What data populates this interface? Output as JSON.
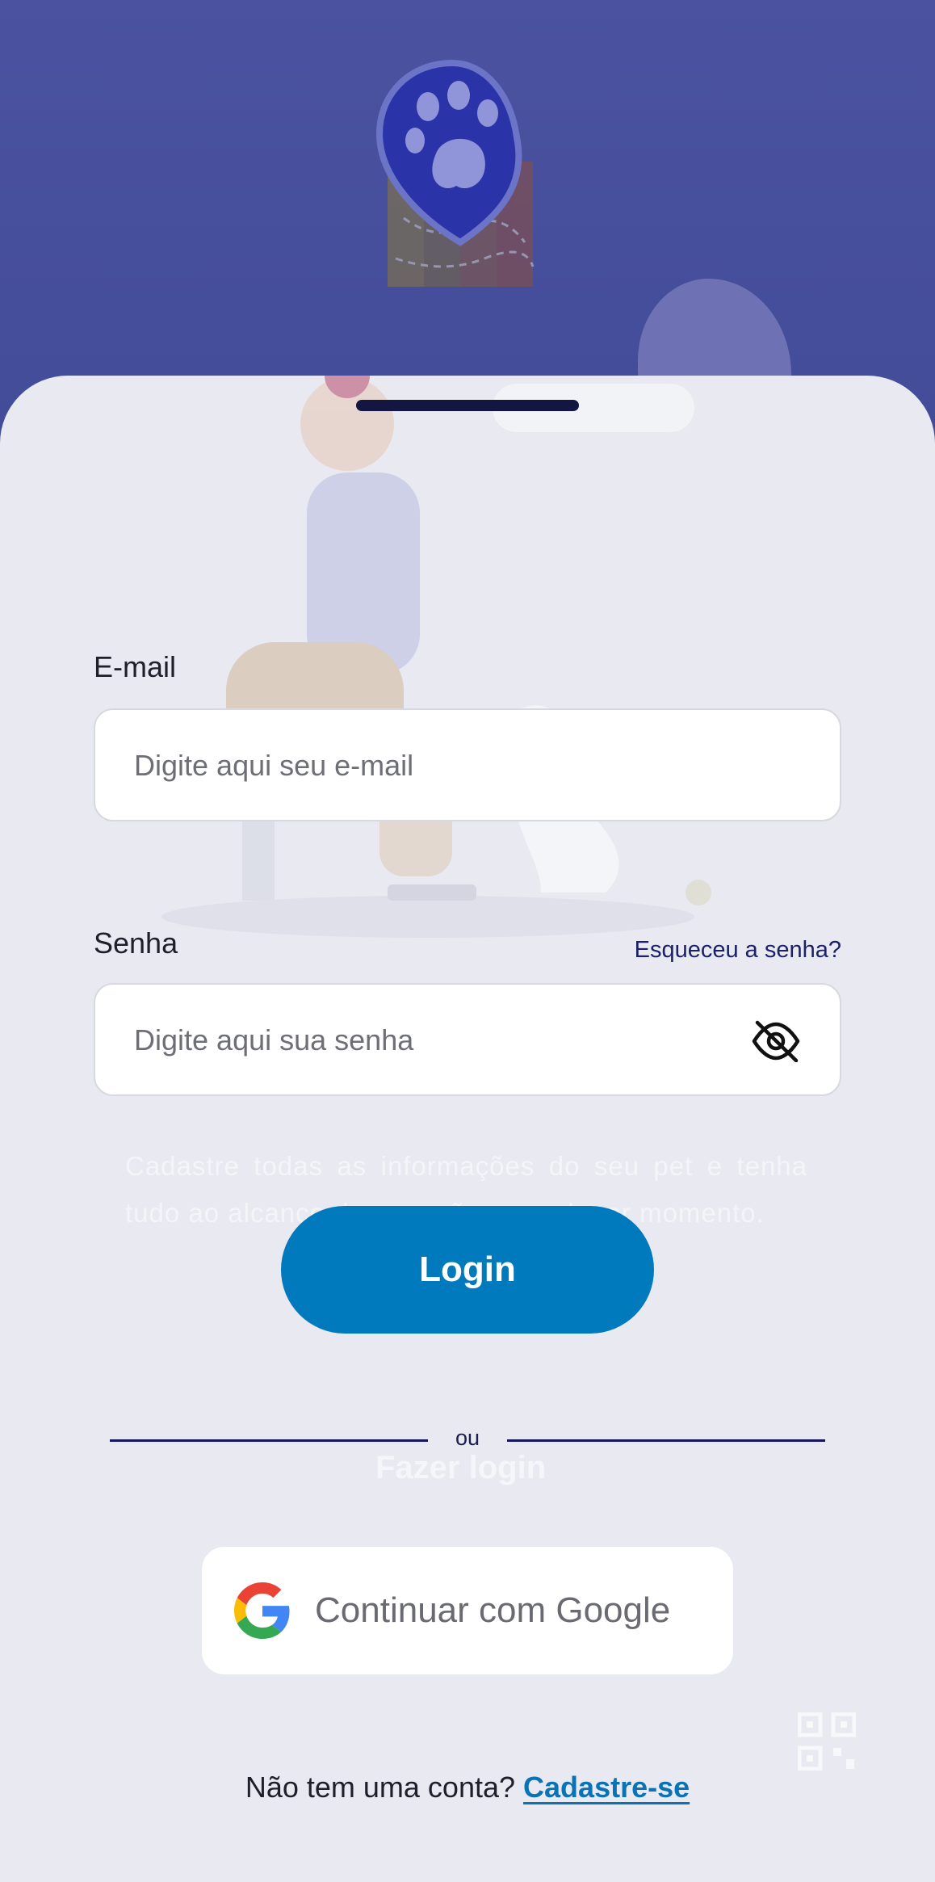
{
  "colors": {
    "header_background": "#4b53a0",
    "sheet_background": "#e8e9f1",
    "primary_button": "#0079bd",
    "link": "#0a73b5",
    "divider": "#121664",
    "forgot_link": "#1b2169"
  },
  "header": {
    "logo_icon": "paw-map-pin-logo"
  },
  "form": {
    "email_label": "E-mail",
    "email_placeholder": "Digite aqui seu e-mail",
    "email_value": "",
    "password_label": "Senha",
    "forgot_password": "Esqueceu a senha?",
    "password_placeholder": "Digite aqui sua senha",
    "password_value": "",
    "password_toggle_icon": "eye-off-icon",
    "login_button": "Login"
  },
  "background_faded": {
    "description_text": "Cadastre todas as informações do seu pet e tenha tudo ao alcance da sua mão, a qualquer momento.",
    "login_text": "Fazer login"
  },
  "divider_label": "ou",
  "google": {
    "icon": "google-icon",
    "label": "Continuar com Google"
  },
  "footer": {
    "prompt": "Não tem uma conta? ",
    "signup_link": "Cadastre-se"
  }
}
